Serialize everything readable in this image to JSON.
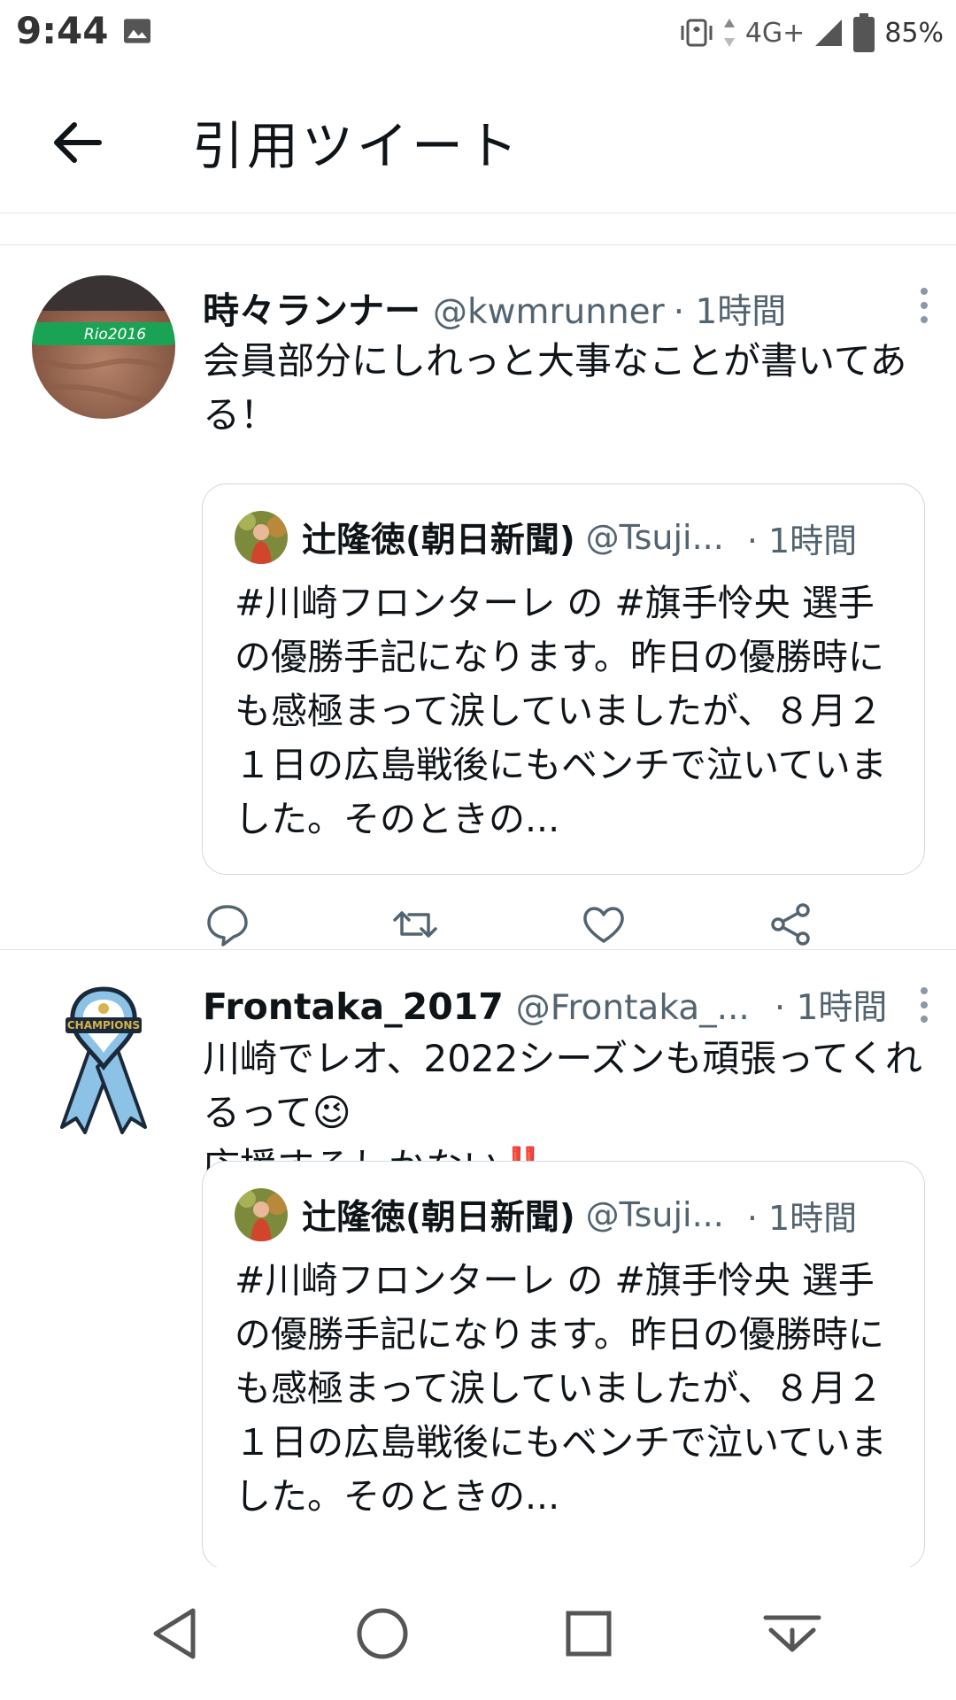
{
  "status_bar": {
    "time": "9:44",
    "network": "4G+",
    "battery": "85%",
    "icons": [
      "image-icon",
      "vibrate-icon",
      "data-arrows-icon",
      "signal-icon",
      "battery-icon"
    ]
  },
  "header": {
    "title": "引用ツイート",
    "back_icon": "arrow-left-icon"
  },
  "tweets": [
    {
      "name": "時々ランナー",
      "handle": "@kwmrunner",
      "time": "· 1時間",
      "text": "会員部分にしれっと大事なことが書いてある！",
      "quote": {
        "name": "辻隆徳(朝日新聞)",
        "handle": "@Tsuji...",
        "time": "· 1時間",
        "text": "#川崎フロンターレ の #旗手怜央 選手の優勝手記になります。昨日の優勝時にも感極まって涙していましたが、８月２１日の広島戦後にもベンチで泣いていました。そのときの..."
      }
    },
    {
      "name": "Frontaka_2017",
      "handle": "@Frontaka_...",
      "time": "· 1時間",
      "text_line1": "川崎でレオ、2022シーズンも頑張ってくれるって",
      "emoji1": "😉",
      "text_line2": "応援するしかない",
      "emoji2": "‼️",
      "quote": {
        "name": "辻隆徳(朝日新聞)",
        "handle": "@Tsuji...",
        "time": "· 1時間",
        "text": "#川崎フロンターレ の #旗手怜央 選手の優勝手記になります。昨日の優勝時にも感極まって涙していましたが、８月２１日の広島戦後にもベンチで泣いていました。そのときの..."
      }
    }
  ],
  "colors": {
    "text": "#0f1419",
    "secondary": "#536471",
    "divider": "#e3e6e8",
    "quote_border": "#cfd9de",
    "avatar_green": "#1aa355"
  }
}
